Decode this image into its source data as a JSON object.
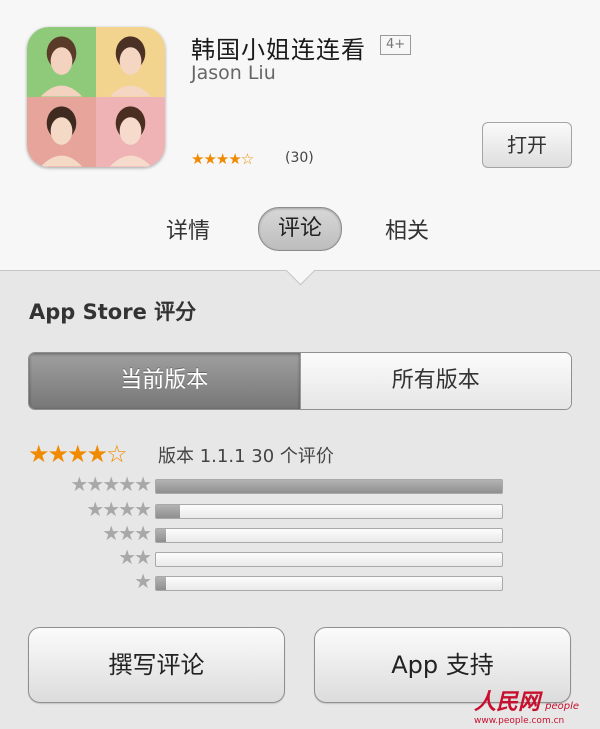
{
  "app": {
    "name": "韩国小姐连连看",
    "age_rating": "4+",
    "developer": "Jason Liu",
    "stars_glyphs": "★★★★☆",
    "rating_value": 4.5,
    "rating_count": "(30)",
    "open_label": "打开"
  },
  "tabs": [
    {
      "label": "详情",
      "active": false
    },
    {
      "label": "评论",
      "active": true
    },
    {
      "label": "相关",
      "active": false
    }
  ],
  "ratings": {
    "section_title": "App Store 评分",
    "segments": [
      {
        "label": "当前版本",
        "active": true
      },
      {
        "label": "所有版本",
        "active": false
      }
    ],
    "summary_stars": "★★★★☆",
    "summary_text": "版本 1.1.1 30 个评价",
    "distribution": [
      {
        "stars": "★★★★★",
        "fraction": 1.0
      },
      {
        "stars": "★★★★",
        "fraction": 0.07
      },
      {
        "stars": "★★★",
        "fraction": 0.03
      },
      {
        "stars": "★★",
        "fraction": 0.0
      },
      {
        "stars": "★",
        "fraction": 0.03
      }
    ]
  },
  "actions": {
    "write_review": "撰写评论",
    "app_support": "App 支持"
  },
  "watermark": {
    "brand": "人民网",
    "latin": "people",
    "url": "www.people.com.cn"
  },
  "colors": {
    "star_orange": "#f08a00",
    "star_gray": "#a8a8a8",
    "watermark_red": "#c8102e"
  }
}
